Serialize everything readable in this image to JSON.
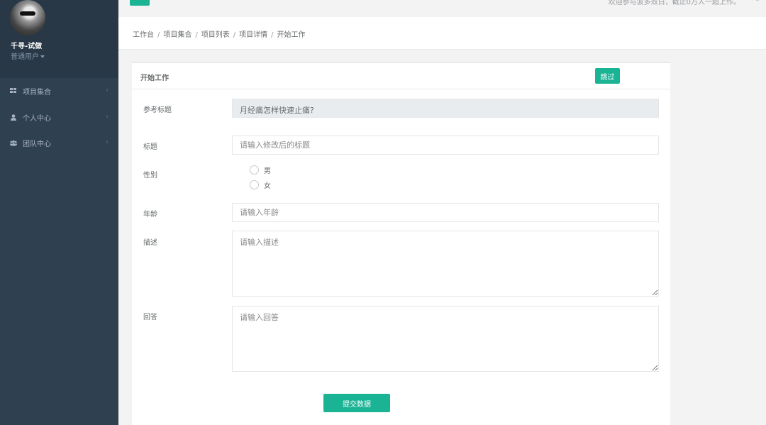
{
  "user": {
    "name": "千寻-试做",
    "role": "普通用户"
  },
  "sidebar": {
    "items": [
      {
        "label": "项目集合",
        "icon": "grid-icon"
      },
      {
        "label": "个人中心",
        "icon": "user-icon"
      },
      {
        "label": "团队中心",
        "icon": "users-icon"
      }
    ]
  },
  "topbar": {
    "welcome": "欢迎参与波多效白，截止0万人一超上作。"
  },
  "breadcrumb": [
    "工作台",
    "项目集合",
    "项目列表",
    "项目详情",
    "开始工作"
  ],
  "panel": {
    "title": "开始工作",
    "skip_label": "跳过",
    "ref_title_label": "参考标题",
    "ref_title_value": "月经痛怎样快速止痛?",
    "title_label": "标题",
    "title_placeholder": "请输入修改后的标题",
    "gender_label": "性别",
    "gender_options": [
      "男",
      "女"
    ],
    "age_label": "年龄",
    "age_placeholder": "请输入年龄",
    "desc_label": "描述",
    "desc_placeholder": "请输入描述",
    "answer_label": "回答",
    "answer_placeholder": "请输入回答",
    "submit_label": "提交数据"
  },
  "colors": {
    "accent": "#1ab394",
    "sidebar": "#2f4050"
  }
}
